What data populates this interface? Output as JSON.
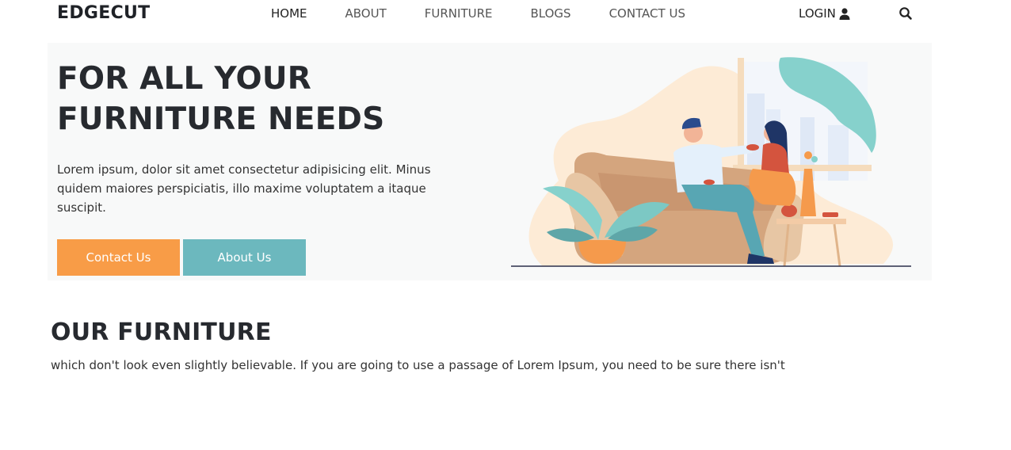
{
  "brand": "EDGECUT",
  "nav": {
    "items": [
      {
        "label": "HOME",
        "active": true
      },
      {
        "label": "ABOUT",
        "active": false
      },
      {
        "label": "FURNITURE",
        "active": false
      },
      {
        "label": "BLOGS",
        "active": false
      },
      {
        "label": "CONTACT US",
        "active": false
      }
    ],
    "login_label": "LOGIN",
    "login_icon": "user-icon",
    "search_icon": "search-icon"
  },
  "hero": {
    "title_line1": "FOR ALL YOUR",
    "title_line2": "FURNITURE NEEDS",
    "description": "Lorem ipsum, dolor sit amet consectetur adipisicing elit. Minus quidem maiores perspiciatis, illo maxime voluptatem a itaque suscipit.",
    "primary_button": "Contact Us",
    "secondary_button": "About Us",
    "illustration": "couple-on-sofa-illustration"
  },
  "furniture_section": {
    "title": "OUR FURNITURE",
    "text": "which don't look even slightly believable. If you are going to use a passage of Lorem Ipsum, you need to be sure there isn't"
  },
  "colors": {
    "accent_orange": "#f89c47",
    "accent_teal": "#6cb8be",
    "hero_bg": "#f8f9f9",
    "text_dark": "#272a2f"
  }
}
